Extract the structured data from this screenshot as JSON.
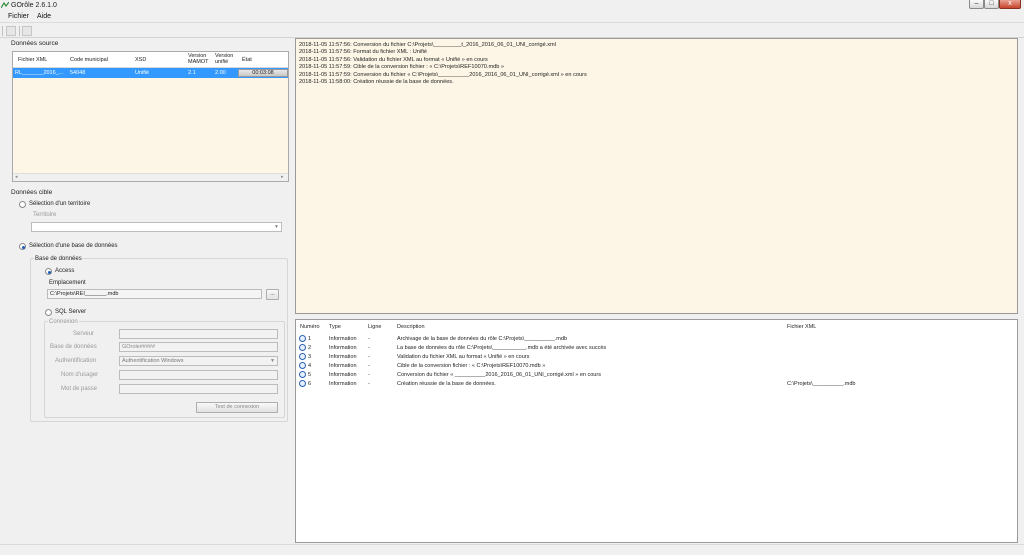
{
  "window": {
    "title": "GOrôle 2.6.1.0",
    "min_label": "–",
    "max_label": "□",
    "close_label": "x"
  },
  "menu": [
    "Fichier",
    "Aide"
  ],
  "source": {
    "group_title": "Données source",
    "columns": [
      "Fichier XML",
      "Code municipal",
      "XSD",
      "Version MAMOT",
      "Version unifié",
      "État"
    ],
    "row": {
      "fichier": "RL_______2016_...",
      "code": "54048",
      "xsd": "Unifié",
      "mamot": "2.1",
      "unifie": "2.00",
      "etat": "00:03:08",
      "progress": 1.0
    }
  },
  "target": {
    "group_title": "Données cible",
    "territory_radio": "Sélection d'un territoire",
    "territory_label": "Territoire",
    "territory_value": "",
    "db_radio": "Sélection d'une base de données",
    "db_group": "Base de données",
    "access_radio": "Access",
    "location_label": "Emplacement",
    "location_value": "C:\\Projets\\REI_______.mdb",
    "browse_label": "...",
    "sql_radio": "SQL Server",
    "connection_label": "Connexion",
    "server_label": "Serveur",
    "server_value": "",
    "db_label": "Base de données",
    "db_value": "GOrole#####",
    "auth_label": "Authentification",
    "auth_value": "Authentification Windows",
    "user_label": "Nom d'usager",
    "user_value": "",
    "pwd_label": "Mot de passe",
    "pwd_value": "",
    "test_button": "Test de connexion"
  },
  "log_lines": [
    "2018-11-05 11:57:56: Conversion du fichier  C:\\Projets\\_________t_2016_2016_06_01_UNI_corrigé.xml",
    "2018-11-05 11:57:56: Format du fichier XML :  Unifié",
    "2018-11-05 11:57:56: Validation du fichier XML au format « Unifié » en cours",
    "2018-11-05 11:57:59: Cible de la conversion fichier : « C:\\Projets\\REF10070.mdb »",
    "2018-11-05 11:57:59: Conversion du fichier « C:\\Projets\\__________2016_2016_06_01_UNI_corrigé.xml » en cours",
    "2018-11-05 11:58:00: Création réussie de la base de données."
  ],
  "messages": {
    "columns": [
      "Numéro",
      "Type",
      "Ligne",
      "Description",
      "Fichier XML"
    ],
    "rows": [
      {
        "num": "1",
        "type": "Information",
        "ligne": "-",
        "desc": "Archivage de la base de données du rôle C:\\Projets\\__________.mdb",
        "file": ""
      },
      {
        "num": "2",
        "type": "Information",
        "ligne": "-",
        "desc": "La base de données du rôle C:\\Projets\\___________.mdb a été archivée avec succès",
        "file": ""
      },
      {
        "num": "3",
        "type": "Information",
        "ligne": "-",
        "desc": "Validation du fichier XML au format « Unifié » en cours",
        "file": ""
      },
      {
        "num": "4",
        "type": "Information",
        "ligne": "-",
        "desc": "Cible de la conversion fichier : « C:\\Projets\\REF10070.mdb »",
        "file": ""
      },
      {
        "num": "5",
        "type": "Information",
        "ligne": "-",
        "desc": "Conversion du fichier « __________2016_2016_06_01_UNI_corrigé.xml » en cours",
        "file": ""
      },
      {
        "num": "6",
        "type": "Information",
        "ligne": "-",
        "desc": "Création réussie de la base de données.",
        "file": "C:\\Projets\\__________.mdb"
      }
    ]
  }
}
